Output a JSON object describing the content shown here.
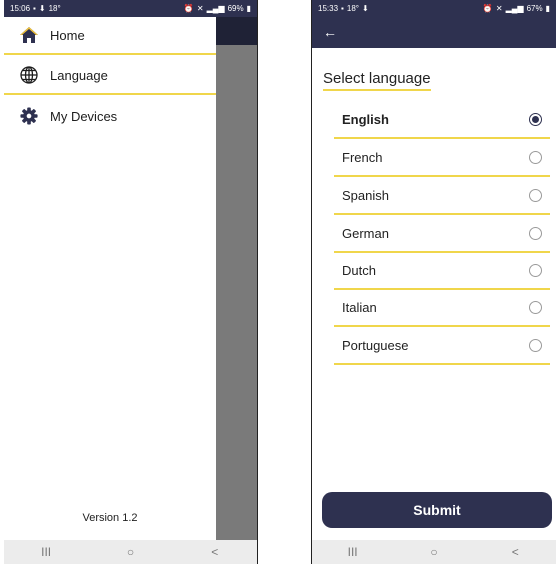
{
  "left_phone": {
    "status": {
      "time": "15:06",
      "temp": "18°",
      "battery": "69%"
    },
    "menu": {
      "items": [
        {
          "label": "Home",
          "icon": "home-icon"
        },
        {
          "label": "Language",
          "icon": "globe-icon"
        },
        {
          "label": "My Devices",
          "icon": "gear-icon"
        }
      ],
      "version": "Version 1.2"
    },
    "nav": {
      "recents": "III",
      "home": "○",
      "back": "<"
    }
  },
  "right_phone": {
    "status": {
      "time": "15:33",
      "temp": "18°",
      "battery": "67%"
    },
    "appbar": {
      "back_glyph": "←"
    },
    "title": "Select language",
    "languages": [
      {
        "label": "English",
        "selected": true
      },
      {
        "label": "French",
        "selected": false
      },
      {
        "label": "Spanish",
        "selected": false
      },
      {
        "label": "German",
        "selected": false
      },
      {
        "label": "Dutch",
        "selected": false
      },
      {
        "label": "Italian",
        "selected": false
      },
      {
        "label": "Portuguese",
        "selected": false
      }
    ],
    "submit_label": "Submit",
    "nav": {
      "recents": "III",
      "home": "○",
      "back": "<"
    }
  },
  "colors": {
    "primary": "#2e3150",
    "accent_divider": "#f0d64b",
    "scrim": "#7a7a7a"
  }
}
